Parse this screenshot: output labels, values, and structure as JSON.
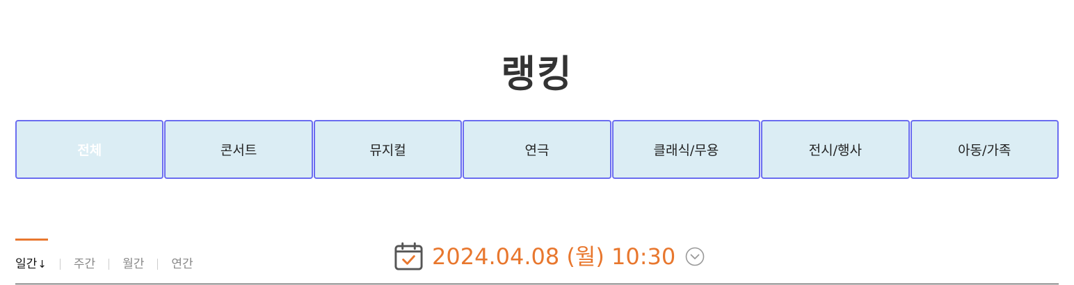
{
  "page": {
    "title": "랭킹"
  },
  "genre_tabs": [
    {
      "label": "전체",
      "active": true
    },
    {
      "label": "콘서트",
      "active": false
    },
    {
      "label": "뮤지컬",
      "active": false
    },
    {
      "label": "연극",
      "active": false
    },
    {
      "label": "클래식/무용",
      "active": false
    },
    {
      "label": "전시/행사",
      "active": false
    },
    {
      "label": "아동/가족",
      "active": false
    }
  ],
  "period_tabs": [
    {
      "label": "일간",
      "active": true,
      "sort_icon": "↓"
    },
    {
      "label": "주간",
      "active": false
    },
    {
      "label": "월간",
      "active": false
    },
    {
      "label": "연간",
      "active": false
    }
  ],
  "date_selector": {
    "value": "2024.04.08 (월) 10:30",
    "icon": "calendar-check-icon",
    "toggle_icon": "chevron-down-circle-icon"
  },
  "colors": {
    "accent": "#e8772e",
    "tab_bg": "#dbedf4",
    "tab_border": "#6a6cf0",
    "title": "#333333"
  }
}
